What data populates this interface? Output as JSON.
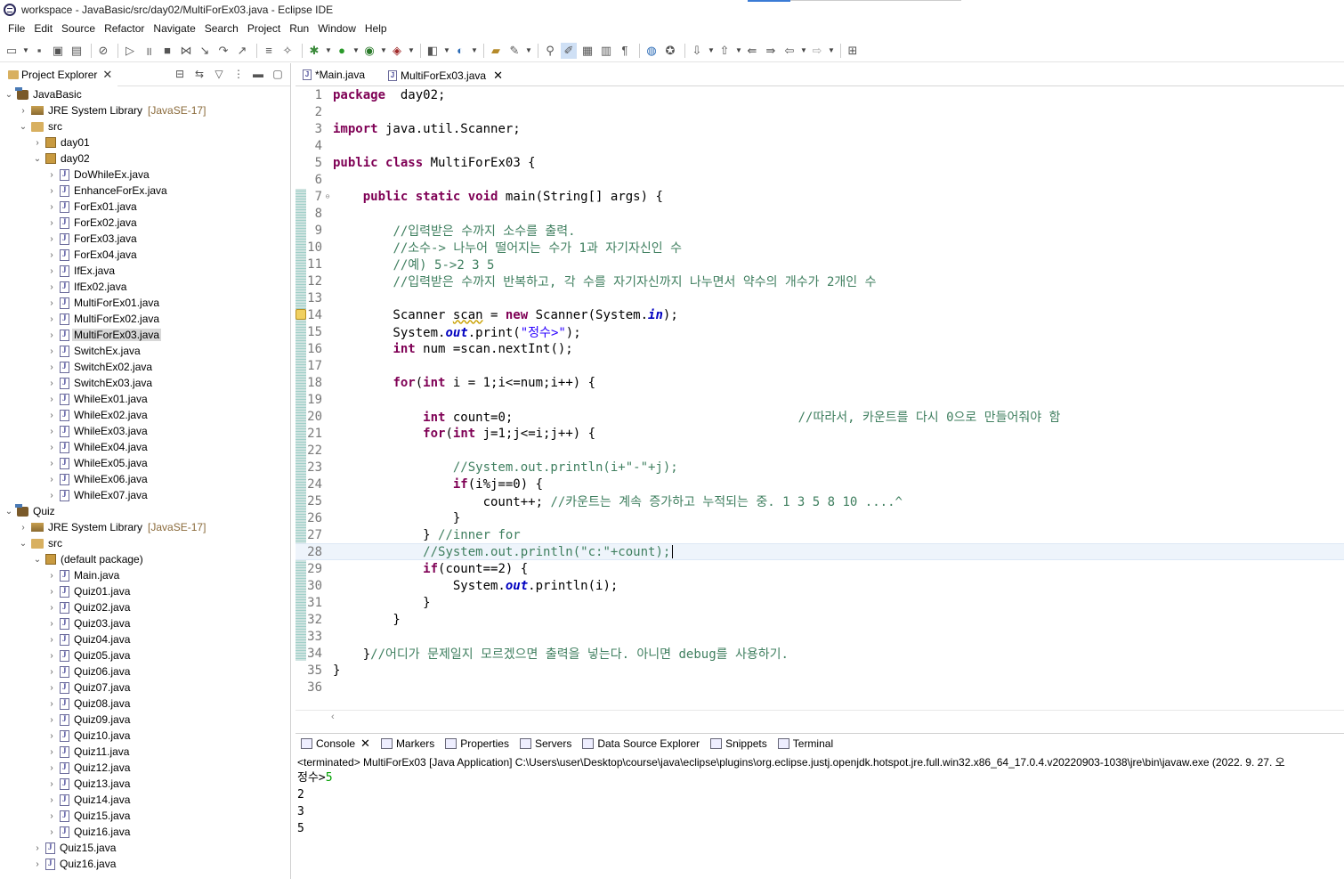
{
  "window": {
    "title": "workspace - JavaBasic/src/day02/MultiForEx03.java - Eclipse IDE"
  },
  "menu": [
    "File",
    "Edit",
    "Source",
    "Refactor",
    "Navigate",
    "Search",
    "Project",
    "Run",
    "Window",
    "Help"
  ],
  "project_explorer": {
    "tab_label": "Project Explorer",
    "tree": [
      {
        "depth": 0,
        "twisty": "open",
        "icon": "project",
        "label": "JavaBasic",
        "extra": ""
      },
      {
        "depth": 1,
        "twisty": "closed",
        "icon": "lib",
        "label": "JRE System Library",
        "extra": "[JavaSE-17]"
      },
      {
        "depth": 1,
        "twisty": "open",
        "icon": "folder",
        "label": "src",
        "extra": ""
      },
      {
        "depth": 2,
        "twisty": "closed",
        "icon": "package",
        "label": "day01",
        "extra": ""
      },
      {
        "depth": 2,
        "twisty": "open",
        "icon": "package",
        "label": "day02",
        "extra": ""
      },
      {
        "depth": 3,
        "twisty": "closed",
        "icon": "jfile",
        "label": "DoWhileEx.java",
        "extra": ""
      },
      {
        "depth": 3,
        "twisty": "closed",
        "icon": "jfile",
        "label": "EnhanceForEx.java",
        "extra": ""
      },
      {
        "depth": 3,
        "twisty": "closed",
        "icon": "jfile",
        "label": "ForEx01.java",
        "extra": ""
      },
      {
        "depth": 3,
        "twisty": "closed",
        "icon": "jfile",
        "label": "ForEx02.java",
        "extra": ""
      },
      {
        "depth": 3,
        "twisty": "closed",
        "icon": "jfile",
        "label": "ForEx03.java",
        "extra": ""
      },
      {
        "depth": 3,
        "twisty": "closed",
        "icon": "jfile",
        "label": "ForEx04.java",
        "extra": ""
      },
      {
        "depth": 3,
        "twisty": "closed",
        "icon": "jfile",
        "label": "IfEx.java",
        "extra": ""
      },
      {
        "depth": 3,
        "twisty": "closed",
        "icon": "jfile",
        "label": "IfEx02.java",
        "extra": ""
      },
      {
        "depth": 3,
        "twisty": "closed",
        "icon": "jfile",
        "label": "MultiForEx01.java",
        "extra": ""
      },
      {
        "depth": 3,
        "twisty": "closed",
        "icon": "jfile",
        "label": "MultiForEx02.java",
        "extra": ""
      },
      {
        "depth": 3,
        "twisty": "closed",
        "icon": "jfile",
        "label": "MultiForEx03.java",
        "extra": "",
        "selected": true
      },
      {
        "depth": 3,
        "twisty": "closed",
        "icon": "jfile",
        "label": "SwitchEx.java",
        "extra": ""
      },
      {
        "depth": 3,
        "twisty": "closed",
        "icon": "jfile",
        "label": "SwitchEx02.java",
        "extra": ""
      },
      {
        "depth": 3,
        "twisty": "closed",
        "icon": "jfile",
        "label": "SwitchEx03.java",
        "extra": ""
      },
      {
        "depth": 3,
        "twisty": "closed",
        "icon": "jfile",
        "label": "WhileEx01.java",
        "extra": ""
      },
      {
        "depth": 3,
        "twisty": "closed",
        "icon": "jfile",
        "label": "WhileEx02.java",
        "extra": ""
      },
      {
        "depth": 3,
        "twisty": "closed",
        "icon": "jfile",
        "label": "WhileEx03.java",
        "extra": ""
      },
      {
        "depth": 3,
        "twisty": "closed",
        "icon": "jfile",
        "label": "WhileEx04.java",
        "extra": ""
      },
      {
        "depth": 3,
        "twisty": "closed",
        "icon": "jfile",
        "label": "WhileEx05.java",
        "extra": ""
      },
      {
        "depth": 3,
        "twisty": "closed",
        "icon": "jfile",
        "label": "WhileEx06.java",
        "extra": ""
      },
      {
        "depth": 3,
        "twisty": "closed",
        "icon": "jfile",
        "label": "WhileEx07.java",
        "extra": ""
      },
      {
        "depth": 0,
        "twisty": "open",
        "icon": "project",
        "label": "Quiz",
        "extra": ""
      },
      {
        "depth": 1,
        "twisty": "closed",
        "icon": "lib",
        "label": "JRE System Library",
        "extra": "[JavaSE-17]"
      },
      {
        "depth": 1,
        "twisty": "open",
        "icon": "folder",
        "label": "src",
        "extra": ""
      },
      {
        "depth": 2,
        "twisty": "open",
        "icon": "package",
        "label": "(default package)",
        "extra": ""
      },
      {
        "depth": 3,
        "twisty": "closed",
        "icon": "jfile",
        "label": "Main.java",
        "extra": ""
      },
      {
        "depth": 3,
        "twisty": "closed",
        "icon": "jfile",
        "label": "Quiz01.java",
        "extra": ""
      },
      {
        "depth": 3,
        "twisty": "closed",
        "icon": "jfile",
        "label": "Quiz02.java",
        "extra": ""
      },
      {
        "depth": 3,
        "twisty": "closed",
        "icon": "jfile",
        "label": "Quiz03.java",
        "extra": ""
      },
      {
        "depth": 3,
        "twisty": "closed",
        "icon": "jfile",
        "label": "Quiz04.java",
        "extra": ""
      },
      {
        "depth": 3,
        "twisty": "closed",
        "icon": "jfile",
        "label": "Quiz05.java",
        "extra": ""
      },
      {
        "depth": 3,
        "twisty": "closed",
        "icon": "jfile",
        "label": "Quiz06.java",
        "extra": ""
      },
      {
        "depth": 3,
        "twisty": "closed",
        "icon": "jfile",
        "label": "Quiz07.java",
        "extra": ""
      },
      {
        "depth": 3,
        "twisty": "closed",
        "icon": "jfile",
        "label": "Quiz08.java",
        "extra": ""
      },
      {
        "depth": 3,
        "twisty": "closed",
        "icon": "jfile",
        "label": "Quiz09.java",
        "extra": ""
      },
      {
        "depth": 3,
        "twisty": "closed",
        "icon": "jfile",
        "label": "Quiz10.java",
        "extra": ""
      },
      {
        "depth": 3,
        "twisty": "closed",
        "icon": "jfile",
        "label": "Quiz11.java",
        "extra": ""
      },
      {
        "depth": 3,
        "twisty": "closed",
        "icon": "jfile",
        "label": "Quiz12.java",
        "extra": ""
      },
      {
        "depth": 3,
        "twisty": "closed",
        "icon": "jfile",
        "label": "Quiz13.java",
        "extra": ""
      },
      {
        "depth": 3,
        "twisty": "closed",
        "icon": "jfile",
        "label": "Quiz14.java",
        "extra": ""
      },
      {
        "depth": 3,
        "twisty": "closed",
        "icon": "jfile",
        "label": "Quiz15.java",
        "extra": ""
      },
      {
        "depth": 3,
        "twisty": "closed",
        "icon": "jfile",
        "label": "Quiz16.java",
        "extra": ""
      },
      {
        "depth": 2,
        "twisty": "closed",
        "icon": "jfile",
        "label": "Quiz15.java",
        "extra": ""
      },
      {
        "depth": 2,
        "twisty": "closed",
        "icon": "jfile",
        "label": "Quiz16.java",
        "extra": ""
      }
    ]
  },
  "editor": {
    "tabs": [
      {
        "label": "*Main.java",
        "active": false
      },
      {
        "label": "MultiForEx03.java",
        "active": true
      }
    ],
    "current_line": 28,
    "lines": [
      [
        [
          "kw",
          "package"
        ],
        [
          "",
          "  day02;"
        ]
      ],
      [],
      [
        [
          "kw",
          "import"
        ],
        [
          "",
          " java.util.Scanner;"
        ]
      ],
      [],
      [
        [
          "kw",
          "public"
        ],
        [
          "",
          " "
        ],
        [
          "kw",
          "class"
        ],
        [
          "",
          " MultiForEx03 {"
        ]
      ],
      [],
      [
        [
          "",
          "    "
        ],
        [
          "kw",
          "public"
        ],
        [
          "",
          " "
        ],
        [
          "kw",
          "static"
        ],
        [
          "",
          " "
        ],
        [
          "kw",
          "void"
        ],
        [
          "",
          " main(String[] args) {"
        ]
      ],
      [],
      [
        [
          "",
          "        "
        ],
        [
          "cm",
          "//입력받은 수까지 소수를 출력."
        ]
      ],
      [
        [
          "",
          "        "
        ],
        [
          "cm",
          "//소수-> 나누어 떨어지는 수가 1과 자기자신인 수"
        ]
      ],
      [
        [
          "",
          "        "
        ],
        [
          "cm",
          "//예) 5->2 3 5"
        ]
      ],
      [
        [
          "",
          "        "
        ],
        [
          "cm",
          "//입력받은 수까지 반복하고, 각 수를 자기자신까지 나누면서 약수의 개수가 2개인 수"
        ]
      ],
      [],
      [
        [
          "",
          "        Scanner "
        ],
        [
          "warn",
          "scan"
        ],
        [
          "",
          " = "
        ],
        [
          "kw",
          "new"
        ],
        [
          "",
          " Scanner(System."
        ],
        [
          "fld",
          "in"
        ],
        [
          "",
          ");"
        ]
      ],
      [
        [
          "",
          "        System."
        ],
        [
          "fld",
          "out"
        ],
        [
          "",
          ".print("
        ],
        [
          "str",
          "\"정수>\""
        ],
        [
          "",
          ");"
        ]
      ],
      [
        [
          "",
          "        "
        ],
        [
          "kw",
          "int"
        ],
        [
          "",
          " num =scan.nextInt();"
        ]
      ],
      [],
      [
        [
          "",
          "        "
        ],
        [
          "kw",
          "for"
        ],
        [
          "",
          "("
        ],
        [
          "kw",
          "int"
        ],
        [
          "",
          " i = 1;i<=num;i++) {"
        ]
      ],
      [],
      [
        [
          "",
          "            "
        ],
        [
          "kw",
          "int"
        ],
        [
          "",
          " count=0;                                      "
        ],
        [
          "cm",
          "//따라서, 카운트를 다시 0으로 만들어줘야 함"
        ]
      ],
      [
        [
          "",
          "            "
        ],
        [
          "kw",
          "for"
        ],
        [
          "",
          "("
        ],
        [
          "kw",
          "int"
        ],
        [
          "",
          " j=1;j<=i;j++) {"
        ]
      ],
      [],
      [
        [
          "",
          "                "
        ],
        [
          "cm",
          "//System.out.println(i+\"-\"+j);"
        ]
      ],
      [
        [
          "",
          "                "
        ],
        [
          "kw",
          "if"
        ],
        [
          "",
          "(i%j==0) {"
        ]
      ],
      [
        [
          "",
          "                    count++; "
        ],
        [
          "cm",
          "//카운트는 계속 증가하고 누적되는 중. 1 3 5 8 10 ....^"
        ]
      ],
      [
        [
          "",
          "                }"
        ]
      ],
      [
        [
          "",
          "            } "
        ],
        [
          "cm",
          "//inner for"
        ]
      ],
      [
        [
          "",
          "            "
        ],
        [
          "cm",
          "//System.out.println(\"c:\"+count);"
        ]
      ],
      [
        [
          "",
          "            "
        ],
        [
          "kw",
          "if"
        ],
        [
          "",
          "(count==2) {"
        ]
      ],
      [
        [
          "",
          "                System."
        ],
        [
          "fld",
          "out"
        ],
        [
          "",
          ".println(i);"
        ]
      ],
      [
        [
          "",
          "            }"
        ]
      ],
      [
        [
          "",
          "        }"
        ]
      ],
      [],
      [
        [
          "",
          "    }"
        ],
        [
          "cm",
          "//어디가 문제일지 모르겠으면 출력을 넣는다. 아니면 debug를 사용하기."
        ]
      ],
      [
        [
          "",
          "}"
        ]
      ],
      []
    ]
  },
  "bottom_panel": {
    "tabs": [
      "Console",
      "Markers",
      "Properties",
      "Servers",
      "Data Source Explorer",
      "Snippets",
      "Terminal"
    ],
    "status": "<terminated> MultiForEx03 [Java Application] C:\\Users\\user\\Desktop\\course\\java\\eclipse\\plugins\\org.eclipse.justj.openjdk.hotspot.jre.full.win32.x86_64_17.0.4.v20220903-1038\\jre\\bin\\javaw.exe  (2022. 9. 27. 오",
    "output": {
      "prompt": "정수>",
      "input": "5",
      "lines": [
        "2",
        "3",
        "5"
      ]
    }
  }
}
